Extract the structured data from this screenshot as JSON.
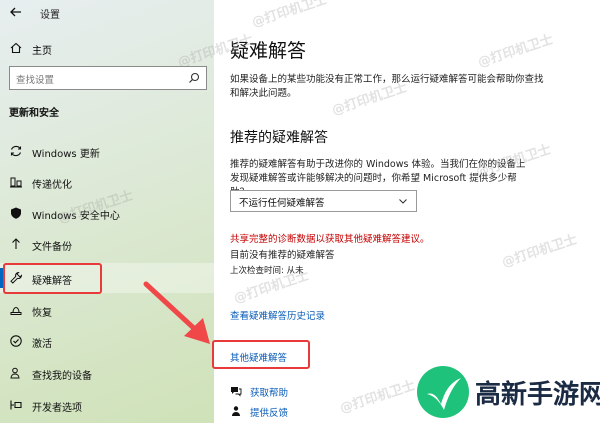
{
  "window": {
    "title": "设置"
  },
  "sidebar": {
    "home_label": "主页",
    "search_placeholder": "查找设置",
    "section_title": "更新和安全",
    "items": [
      {
        "label": "Windows 更新",
        "icon": "sync-icon"
      },
      {
        "label": "传递优化",
        "icon": "delivery-icon"
      },
      {
        "label": "Windows 安全中心",
        "icon": "shield-icon"
      },
      {
        "label": "文件备份",
        "icon": "backup-arrow-icon"
      },
      {
        "label": "疑难解答",
        "icon": "wrench-icon",
        "active": true
      },
      {
        "label": "恢复",
        "icon": "recovery-icon"
      },
      {
        "label": "激活",
        "icon": "check-circle-icon"
      },
      {
        "label": "查找我的设备",
        "icon": "person-locate-icon"
      },
      {
        "label": "开发者选项",
        "icon": "developer-icon"
      }
    ]
  },
  "main": {
    "title": "疑难解答",
    "description": "如果设备上的某些功能没有正常工作，那么运行疑难解答可能会帮助你查找和解决此问题。",
    "recommended_title": "推荐的疑难解答",
    "recommended_desc": "推荐的疑难解答有助于改进你的 Windows 体验。当我们在你的设备上发现疑难解答或许能够解决的问题时，你希望 Microsoft 提供多少帮助？",
    "dropdown_value": "不运行任何疑难解答",
    "warning": "共享完整的诊断数据以获取其他疑难解答建议。",
    "status_none": "目前没有推荐的疑难解答",
    "last_checked": "上次检查时间: 从未",
    "history_link": "查看疑难解答历史记录",
    "other_link": "其他疑难解答",
    "get_help": "获取帮助",
    "feedback": "提供反馈"
  },
  "watermark": "@打印机卫士",
  "logo": {
    "text": "高新手游网"
  },
  "colors": {
    "accent": "#0067c0",
    "link": "#0a5cb8",
    "warning": "#c40000",
    "annotation": "#e83a3a"
  }
}
